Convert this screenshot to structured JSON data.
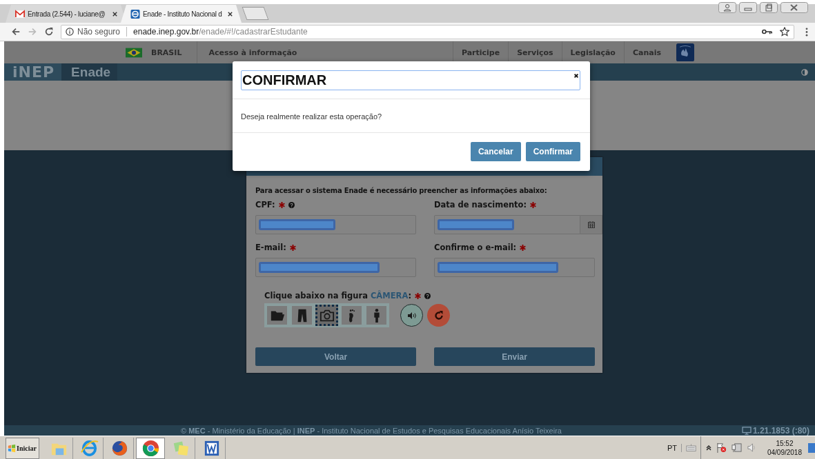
{
  "browser": {
    "tabs": [
      {
        "title": "Entrada (2.544) - luciane@",
        "selected": false
      },
      {
        "title": "Enade - Instituto Nacional d",
        "selected": true
      }
    ],
    "security": "Não seguro",
    "url_host": "enade.inep.gov.br",
    "url_path": "/enade/#!/cadastrarEstudante"
  },
  "gov_bar": {
    "country": "BRASIL",
    "left_links": [
      "Acesso à informação"
    ],
    "right_links": [
      "Participe",
      "Serviços",
      "Legislação",
      "Canais"
    ]
  },
  "header": {
    "logo": "iNEP",
    "title": "Enade"
  },
  "form": {
    "intro": "Para acessar o sistema Enade é necessário preencher as informações abaixo:",
    "fields": [
      {
        "label": "CPF:",
        "required": true,
        "help": true,
        "redacted": true,
        "calendar": false
      },
      {
        "label": "Data de nascimento:",
        "required": true,
        "help": false,
        "redacted": true,
        "calendar": true
      },
      {
        "label": "E-mail:",
        "required": true,
        "help": false,
        "redacted": true,
        "calendar": false
      },
      {
        "label": "Confirme o e-mail:",
        "required": true,
        "help": false,
        "redacted": true,
        "calendar": false
      }
    ],
    "figure_prompt": "Clique abaixo na figura",
    "figure_word": "CÂMERA",
    "figure_colon": ":",
    "figure_required": true,
    "figure_help": true,
    "figures": [
      {
        "selected": false
      },
      {
        "selected": false
      },
      {
        "selected": true
      },
      {
        "selected": false
      },
      {
        "selected": false
      }
    ],
    "buttons": [
      "Voltar",
      "Enviar"
    ]
  },
  "footer": {
    "credit": "© **MEC** - Ministério da Educação | **INEP** - Instituto Nacional de Estudos e Pesquisas Educacionais Anísio Teixeira",
    "version": "1.21.1853 (:80)"
  },
  "dialog": {
    "title": "CONFIRMAR",
    "message": "Deseja realmente realizar esta operação?",
    "buttons": [
      "Cancelar",
      "Confirmar"
    ]
  },
  "taskbar": {
    "start": "Iniciar",
    "apps": [
      {
        "selected": false
      },
      {
        "selected": false
      },
      {
        "selected": false
      },
      {
        "selected": true
      },
      {
        "selected": false
      },
      {
        "selected": false
      }
    ],
    "language": "PT",
    "time": "15:52",
    "date": "04/09/2018"
  }
}
